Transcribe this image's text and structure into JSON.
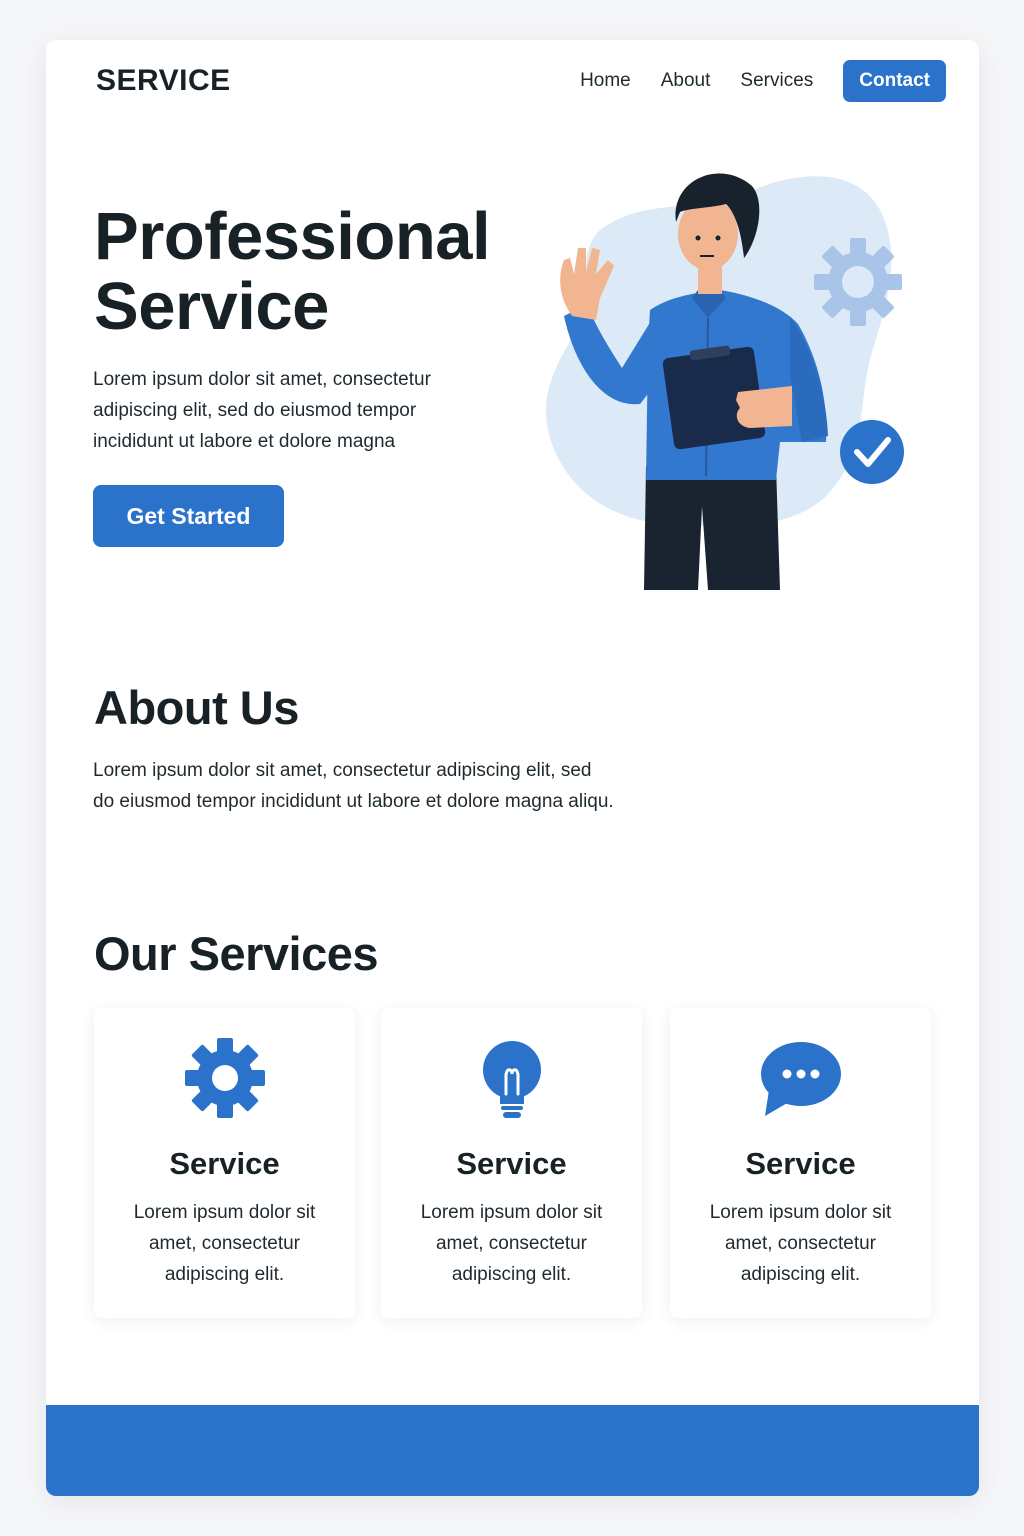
{
  "colors": {
    "accent": "#2b72cb",
    "text": "#172126",
    "blob": "#dce9f7",
    "background": "#ffffff"
  },
  "nav": {
    "logo": "SERVICE",
    "links": [
      "Home",
      "About",
      "Services"
    ],
    "cta": "Contact"
  },
  "hero": {
    "title_line1": "Professional",
    "title_line2": "Service",
    "text_lines": [
      "Lorem ipsum dolor sit amet, consectetur",
      "adipiscing elit, sed do eiusmod tempor",
      "incididunt ut labore et dolore magna"
    ],
    "button": "Get Started"
  },
  "about": {
    "title": "About Us",
    "text_lines": [
      "Lorem ipsum dolor sit amet, consectetur adipiscing elit, sed",
      "do eiusmod tempor incididunt ut labore et dolore magna aliqu."
    ]
  },
  "services": {
    "title": "Our Services",
    "cards": [
      {
        "icon": "gear-icon",
        "title": "Service",
        "text_lines": [
          "Lorem ipsum dolor sit",
          "amet, consectetur",
          "adipiscing elit."
        ]
      },
      {
        "icon": "lightbulb-icon",
        "title": "Service",
        "text_lines": [
          "Lorem ipsum dolor sit",
          "amet, consectetur",
          "adipiscing elit."
        ]
      },
      {
        "icon": "chat-bubble-icon",
        "title": "Service",
        "text_lines": [
          "Lorem ipsum dolor sit",
          "amet, consectetur",
          "adipiscing elit."
        ]
      }
    ]
  }
}
